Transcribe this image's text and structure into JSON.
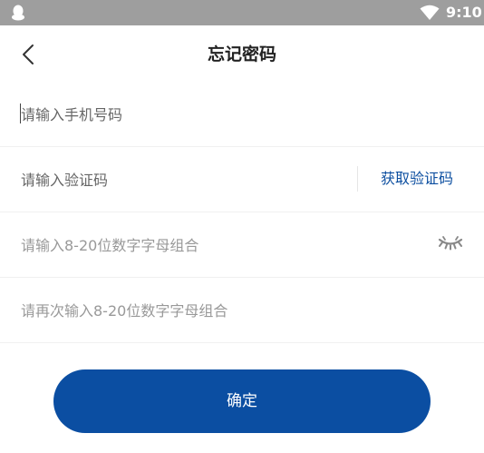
{
  "status_bar": {
    "time": "9:10",
    "left_icon": "qq-penguin-icon",
    "wifi_icon": "wifi-icon",
    "background": "#9e9e9e"
  },
  "header": {
    "back_icon": "chevron-left-icon",
    "title": "忘记密码"
  },
  "form": {
    "phone_placeholder": "请输入手机号码",
    "code_placeholder": "请输入验证码",
    "get_code_label": "获取验证码",
    "password_placeholder": "请输入8-20位数字字母组合",
    "password_toggle_icon": "eye-closed-icon",
    "confirm_password_placeholder": "请再次输入8-20位数字字母组合"
  },
  "actions": {
    "submit_label": "确定"
  },
  "colors": {
    "accent": "#0b4ea2",
    "link": "#0d4fa0"
  }
}
